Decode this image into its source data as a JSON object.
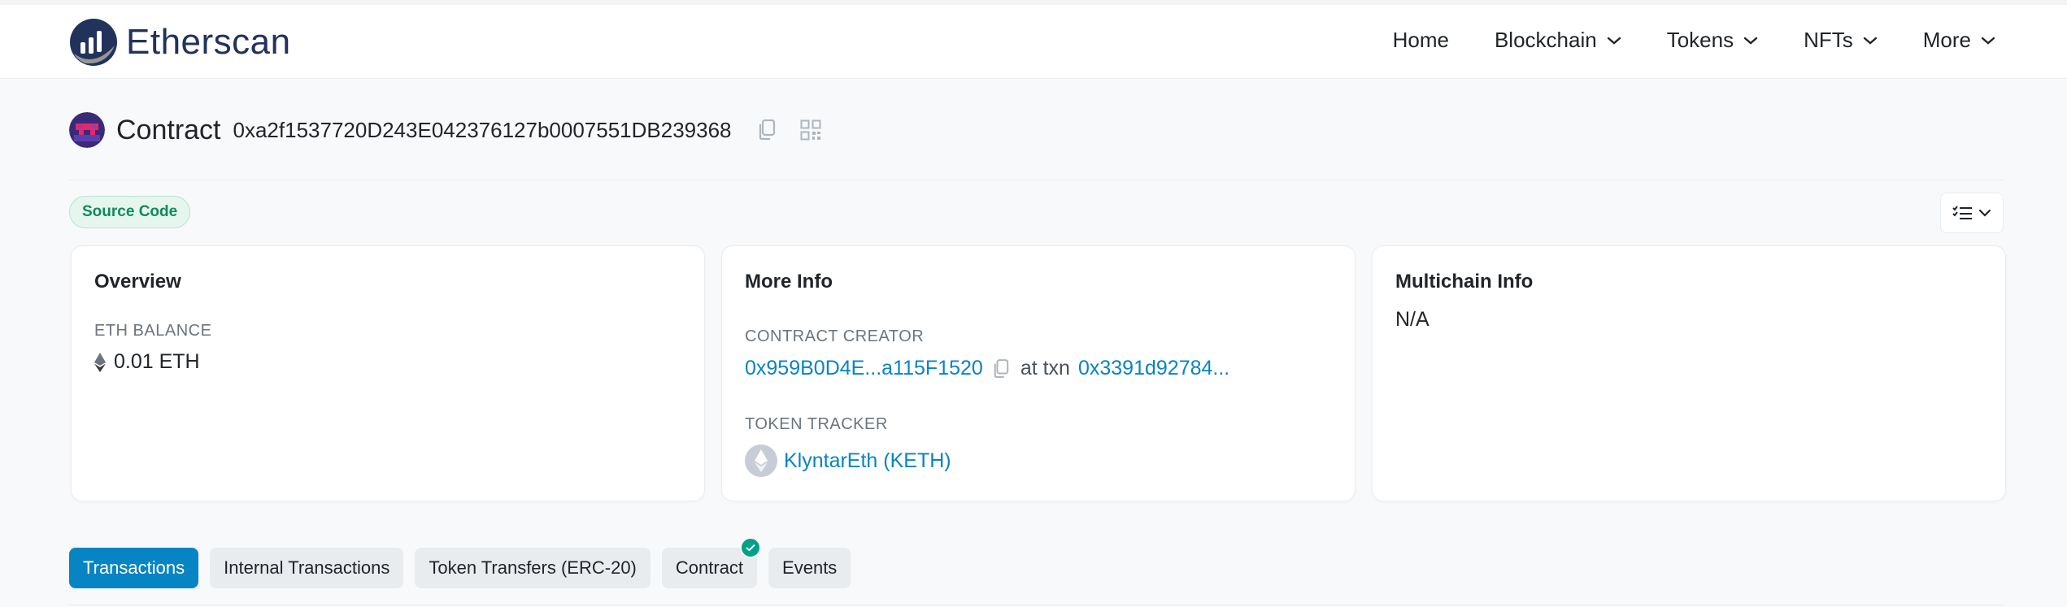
{
  "brand": {
    "name": "Etherscan"
  },
  "nav": {
    "home": "Home",
    "blockchain": "Blockchain",
    "tokens": "Tokens",
    "nfts": "NFTs",
    "more": "More"
  },
  "header": {
    "label": "Contract",
    "address": "0xa2f1537720D243E042376127b0007551DB239368"
  },
  "badge": {
    "source_code": "Source Code"
  },
  "overview": {
    "title": "Overview",
    "eth_balance_label": "ETH BALANCE",
    "eth_balance_value": "0.01 ETH"
  },
  "more_info": {
    "title": "More Info",
    "creator_label": "CONTRACT CREATOR",
    "creator_address": "0x959B0D4E...a115F1520",
    "at_txn": "at txn",
    "txn_hash": "0x3391d92784...",
    "token_tracker_label": "TOKEN TRACKER",
    "token_name": "KlyntarEth (KETH)"
  },
  "multichain": {
    "title": "Multichain Info",
    "value": "N/A"
  },
  "tabs": {
    "transactions": "Transactions",
    "internal": "Internal Transactions",
    "token_transfers": "Token Transfers (ERC-20)",
    "contract": "Contract",
    "events": "Events"
  },
  "colors": {
    "brand": "#21325b",
    "link": "#0784c3",
    "success": "#00a186"
  },
  "icons": [
    "etherscan-logo-icon",
    "chevron-down-icon",
    "copy-icon",
    "qr-code-icon",
    "list-view-icon",
    "ethereum-icon",
    "check-icon"
  ]
}
